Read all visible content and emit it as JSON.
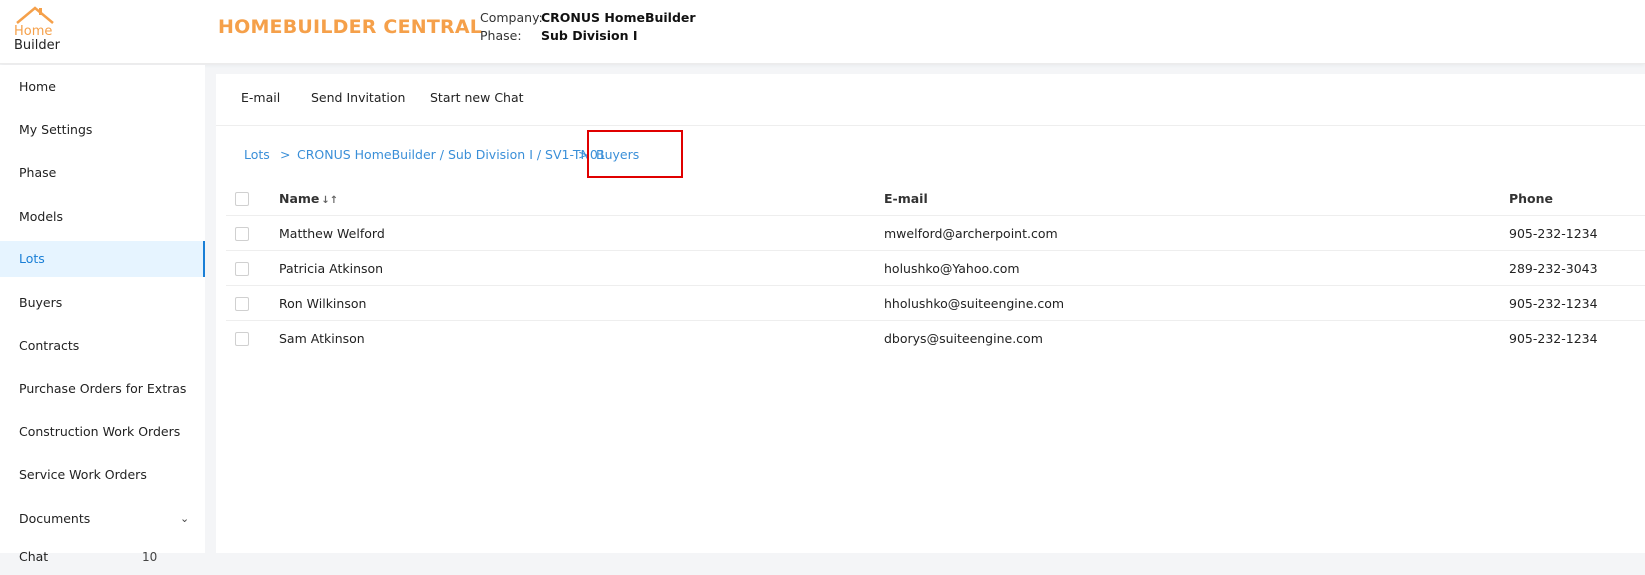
{
  "logo": {
    "line1": "Home",
    "line2": "Builder"
  },
  "header": {
    "app_title": "HOMEBUILDER CENTRAL",
    "company_label": "Company:",
    "company_value": "CRONUS HomeBuilder",
    "phase_label": "Phase:",
    "phase_value": "Sub Division I"
  },
  "sidebar": {
    "items": [
      {
        "label": "Home"
      },
      {
        "label": "My Settings"
      },
      {
        "label": "Phase"
      },
      {
        "label": "Models"
      },
      {
        "label": "Lots",
        "active": true
      },
      {
        "label": "Buyers"
      },
      {
        "label": "Contracts"
      },
      {
        "label": "Purchase Orders for Extras"
      },
      {
        "label": "Construction Work Orders"
      },
      {
        "label": "Service Work Orders"
      },
      {
        "label": "Documents"
      },
      {
        "label": "Chat",
        "badge": "10"
      }
    ]
  },
  "toolbar": {
    "email_label": "E-mail",
    "send_invitation_label": "Send Invitation",
    "start_chat_label": "Start new Chat"
  },
  "breadcrumb": {
    "lots": "Lots",
    "separator": ">",
    "lot_path": "CRONUS HomeBuilder / Sub Division I / SV1-TN01",
    "buyers": "Buyers"
  },
  "table": {
    "columns": {
      "name": "Name",
      "email": "E-mail",
      "phone": "Phone"
    },
    "rows": [
      {
        "name": "Matthew Welford",
        "email": "mwelford@archerpoint.com",
        "phone": "905-232-1234"
      },
      {
        "name": "Patricia Atkinson",
        "email": "holushko@Yahoo.com",
        "phone": "289-232-3043"
      },
      {
        "name": "Ron Wilkinson",
        "email": "hholushko@suiteengine.com",
        "phone": "905-232-1234"
      },
      {
        "name": "Sam Atkinson",
        "email": "dborys@suiteengine.com",
        "phone": "905-232-1234"
      }
    ]
  },
  "colors": {
    "brand_orange": "#f5a04a",
    "link_blue": "#3a8fd8",
    "active_blue": "#1a7fd6",
    "highlight_red": "#e00000"
  }
}
